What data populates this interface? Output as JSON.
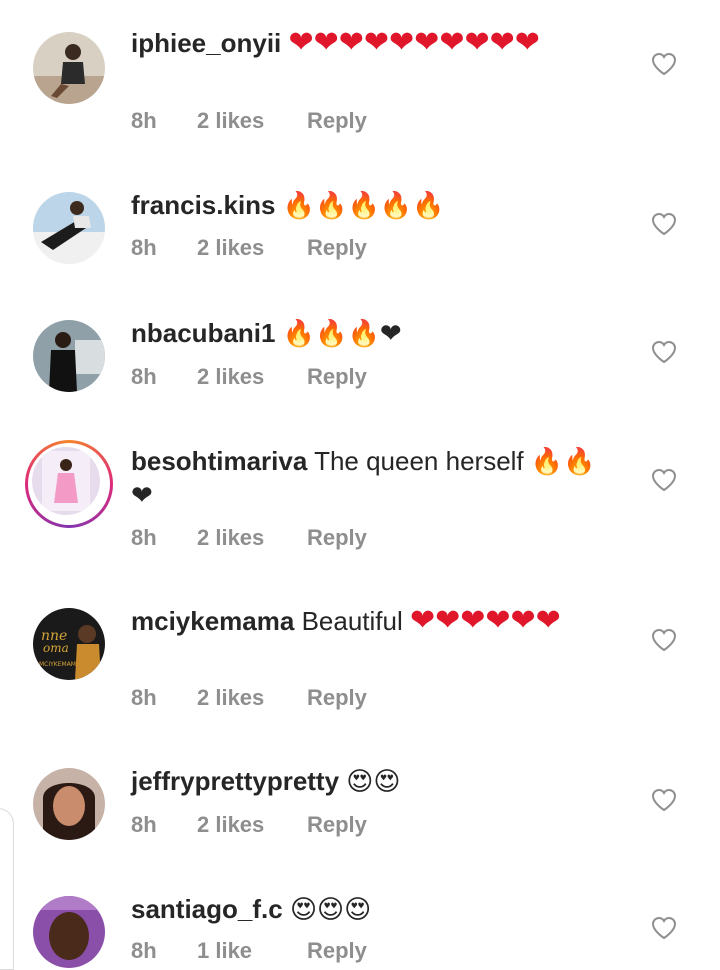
{
  "comments": [
    {
      "username": "iphiee_onyii",
      "text": "",
      "emojis": "❤❤❤❤❤❤❤❤❤❤",
      "time": "8h",
      "likes": "2 likes",
      "reply": "Reply",
      "avatar": "woman-sitting"
    },
    {
      "username": "francis.kins",
      "text": "",
      "emojis": "🔥🔥🔥🔥🔥",
      "time": "8h",
      "likes": "2 likes",
      "reply": "Reply",
      "avatar": "man-reclining"
    },
    {
      "username": "nbacubani1",
      "text": "",
      "emojis": "🔥🔥🔥❤",
      "time": "8h",
      "likes": "2 likes",
      "reply": "Reply",
      "avatar": "man-standing"
    },
    {
      "username": "besohtimariva",
      "text": "The queen herself",
      "emojis": "🔥🔥❤",
      "time": "8h",
      "likes": "2 likes",
      "reply": "Reply",
      "avatar": "woman-pink-dress"
    },
    {
      "username": "mciykemama",
      "text": "Beautiful",
      "emojis": "❤❤❤❤❤❤",
      "time": "8h",
      "likes": "2 likes",
      "reply": "Reply",
      "avatar": "logo-mciykemama"
    },
    {
      "username": "jeffryprettypretty",
      "text": "",
      "emojis": "😍😍",
      "time": "8h",
      "likes": "2 likes",
      "reply": "Reply",
      "avatar": "woman-portrait"
    },
    {
      "username": "santiago_f.c",
      "text": "",
      "emojis": "😍😍😍",
      "time": "8h",
      "likes": "1 like",
      "reply": "Reply",
      "avatar": "man-portrait"
    }
  ],
  "colors": {
    "username": "#262626",
    "meta": "#8e8e8e",
    "heart": "#e0162b",
    "story_ring": "#dd2a7b"
  },
  "avatar_logo_text": "MCIYKEMAMA"
}
